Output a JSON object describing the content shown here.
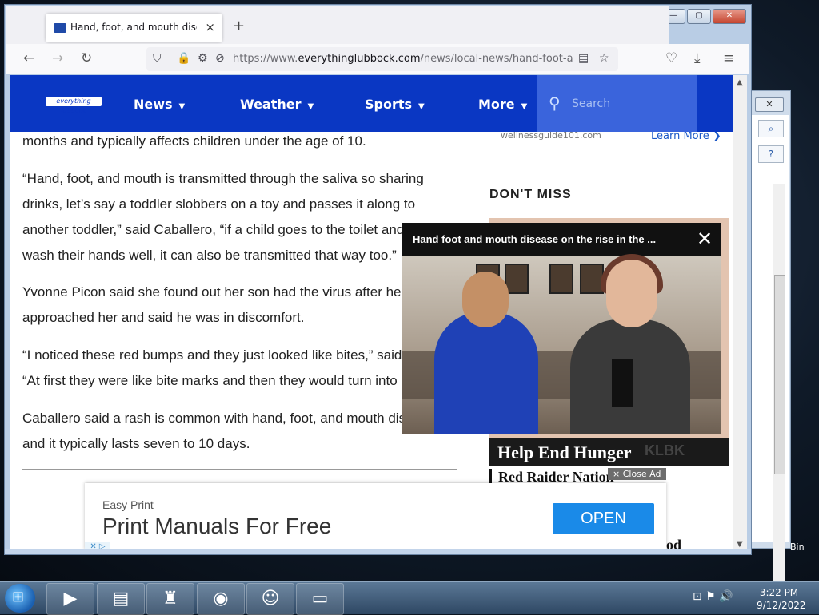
{
  "browser": {
    "tab_title": "Hand, foot, and mouth disease",
    "tab_close": "×",
    "new_tab": "+",
    "url_prefix": "https://www.",
    "url_domain": "everythinglubbock.com",
    "url_path": "/news/local-news/hand-foot-an"
  },
  "site": {
    "logo": "everything lubbock",
    "nav": [
      "News",
      "Weather",
      "Sports",
      "More"
    ],
    "search_placeholder": "Search"
  },
  "article": {
    "p0": "months and typically affects children under the age of 10.",
    "p1": "“Hand, foot, and mouth is transmitted through the saliva so sharing drinks, let’s say a toddler slobbers on a toy and passes it along to another toddler,” said Caballero, “if a child goes to the toilet and doesn’t wash their hands well, it can also be transmitted that way too.”",
    "p2": "Yvonne Picon said she found out her son had the virus after he approached her and said he was in discomfort.",
    "p3": "“I noticed these red bumps and they just looked like bites,” said Picon. “At first they were like bite marks and then they would turn into",
    "p4": "Caballero said a rash is common with hand, foot, and mouth disease and it typically lasts seven to 10 days."
  },
  "sidebar": {
    "sponsor": "wellnessguide101.com",
    "learn_more": "Learn More ❯",
    "dont_miss": "DON'T MISS",
    "card_banner": "Help End Hunger",
    "card_banner_tag": "KLBK",
    "card_sub": "Red Raider Nation",
    "card_sub2": "ood"
  },
  "video": {
    "title": "Hand foot and mouth disease on the rise in the ...",
    "close": "✕"
  },
  "close_ad": "× Close Ad",
  "ad": {
    "brand": "Easy Print",
    "headline": "Print Manuals For Free",
    "button": "OPEN"
  },
  "desktop": {
    "bin_label": "Bin"
  },
  "taskbar": {
    "time": "3:22 PM",
    "date": "9/12/2022"
  }
}
